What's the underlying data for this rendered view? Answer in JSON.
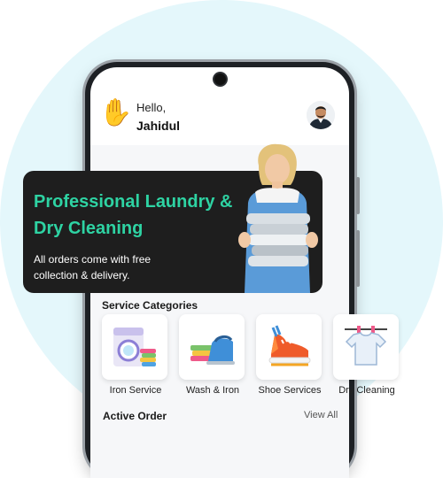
{
  "header": {
    "greeting": "Hello,",
    "user_name": "Jahidul",
    "wave_icon": "waving-hand-icon",
    "avatar_icon": "user-avatar"
  },
  "banner": {
    "title": "Professional Laundry & Dry Cleaning",
    "subtitle": "All orders come with free collection & delivery.",
    "title_color": "#2ed3a3",
    "background": "#1e1e1e"
  },
  "services": {
    "title": "Service Categories",
    "items": [
      {
        "label": "Iron Service",
        "icon": "washing-machine-icon"
      },
      {
        "label": "Wash & Iron",
        "icon": "iron-icon"
      },
      {
        "label": "Shoe Services",
        "icon": "sneaker-icon"
      },
      {
        "label": "Dry Cleaning",
        "icon": "tshirt-hanger-icon"
      }
    ]
  },
  "active_order": {
    "title": "Active Order",
    "view_all": "View All"
  }
}
